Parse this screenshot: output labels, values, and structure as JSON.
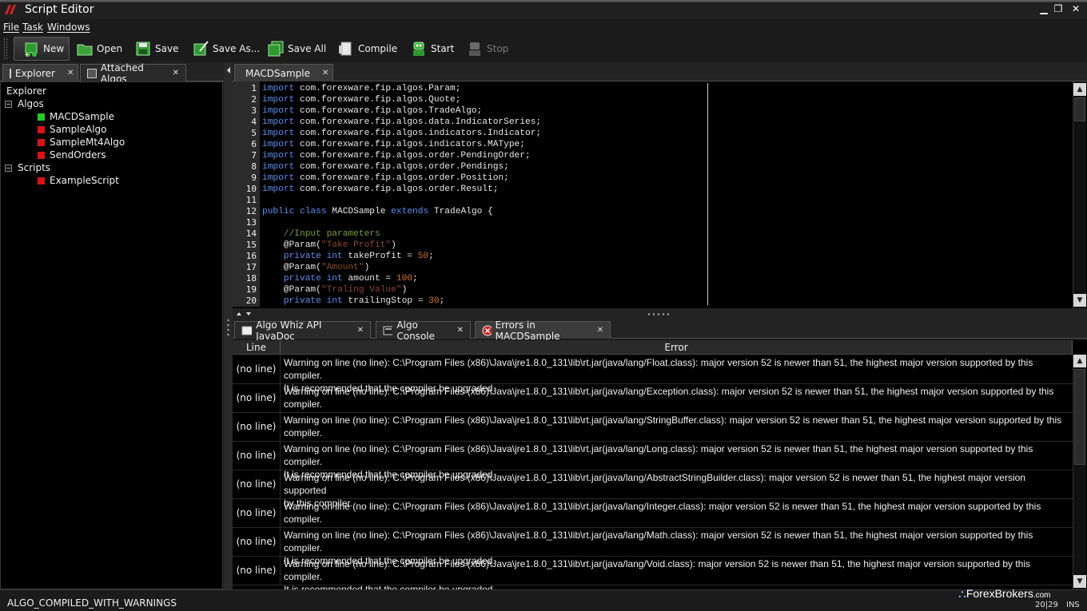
{
  "window": {
    "title": "Script Editor"
  },
  "menu": {
    "file": "File",
    "task": "Task",
    "windows": "Windows"
  },
  "toolbar": {
    "new": "New",
    "open": "Open",
    "save": "Save",
    "save_as": "Save As...",
    "save_all": "Save All",
    "compile": "Compile",
    "start": "Start",
    "stop": "Stop"
  },
  "left_tabs": {
    "explorer": "Explorer",
    "attached": "Attached Algos"
  },
  "explorer": {
    "root": "Explorer",
    "algos_label": "Algos",
    "algos": [
      {
        "name": "MACDSample",
        "status_color": "#22cc22"
      },
      {
        "name": "SampleAlgo",
        "status_color": "#dd1111"
      },
      {
        "name": "SampleMt4Algo",
        "status_color": "#dd1111"
      },
      {
        "name": "SendOrders",
        "status_color": "#dd1111"
      }
    ],
    "scripts_label": "Scripts",
    "scripts": [
      {
        "name": "ExampleScript",
        "status_color": "#dd1111"
      }
    ]
  },
  "editor": {
    "tab": "MACDSample",
    "line_numbers": [
      "1",
      "2",
      "3",
      "4",
      "5",
      "6",
      "7",
      "8",
      "9",
      "10",
      "11",
      "12",
      "13",
      "14",
      "15",
      "16",
      "17",
      "18",
      "19",
      "20"
    ]
  },
  "bottom_tabs": {
    "javadoc": "Algo Whiz API JavaDoc",
    "console": "Algo Console",
    "errors": "Errors in MACDSample"
  },
  "errors_table": {
    "col_line": "Line",
    "col_error": "Error",
    "rows": [
      {
        "line": "(no line)",
        "l1": "Warning on line (no line): C:\\Program Files (x86)\\Java\\jre1.8.0_131\\lib\\rt.jar(java/lang/Float.class): major version 52 is newer than 51, the highest major version supported by this compiler.",
        "l2": "It is recommended that the compiler be upgraded."
      },
      {
        "line": "(no line)",
        "l1": "Warning on line (no line): C:\\Program Files (x86)\\Java\\jre1.8.0_131\\lib\\rt.jar(java/lang/Exception.class): major version 52 is newer than 51, the highest major version supported by this",
        "l2": "compiler."
      },
      {
        "line": "(no line)",
        "l1": "Warning on line (no line): C:\\Program Files (x86)\\Java\\jre1.8.0_131\\lib\\rt.jar(java/lang/StringBuffer.class): major version 52 is newer than 51, the highest major version supported by this",
        "l2": "compiler."
      },
      {
        "line": "(no line)",
        "l1": "Warning on line (no line): C:\\Program Files (x86)\\Java\\jre1.8.0_131\\lib\\rt.jar(java/lang/Long.class): major version 52 is newer than 51, the highest major version supported by this compiler.",
        "l2": "It is recommended that the compiler be upgraded."
      },
      {
        "line": "(no line)",
        "l1": "Warning on line (no line): C:\\Program Files (x86)\\Java\\jre1.8.0_131\\lib\\rt.jar(java/lang/AbstractStringBuilder.class): major version 52 is newer than 51, the highest major version supported",
        "l2": "by this compiler."
      },
      {
        "line": "(no line)",
        "l1": "Warning on line (no line): C:\\Program Files (x86)\\Java\\jre1.8.0_131\\lib\\rt.jar(java/lang/Integer.class): major version 52 is newer than 51, the highest major version supported by this",
        "l2": "compiler."
      },
      {
        "line": "(no line)",
        "l1": "Warning on line (no line): C:\\Program Files (x86)\\Java\\jre1.8.0_131\\lib\\rt.jar(java/lang/Math.class): major version 52 is newer than 51, the highest major version supported by this compiler.",
        "l2": "It is recommended that the compiler be upgraded."
      },
      {
        "line": "(no line)",
        "l1": "Warning on line (no line): C:\\Program Files (x86)\\Java\\jre1.8.0_131\\lib\\rt.jar(java/lang/Void.class): major version 52 is newer than 51, the highest major version supported by this compiler.",
        "l2": "It is recommended that the compiler be upgraded."
      }
    ]
  },
  "status": {
    "message": "ALGO_COMPILED_WITH_WARNINGS",
    "cursor": "20|29",
    "mode": "INS",
    "watermark": "ForexBrokers",
    "watermark_suffix": ".com"
  }
}
